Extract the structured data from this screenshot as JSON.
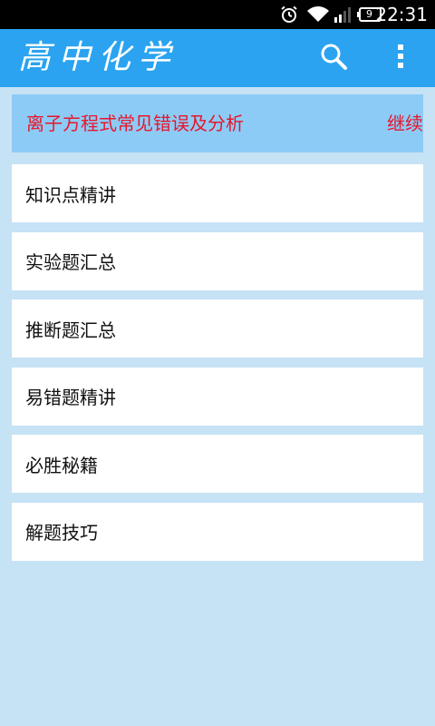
{
  "status_bar": {
    "time": "22:31",
    "battery_level": "9",
    "icons": [
      "alarm-icon",
      "wifi-icon",
      "signal-icon",
      "battery-icon"
    ]
  },
  "app_bar": {
    "title": "高中化学",
    "color": "#2ba3f0",
    "actions": [
      "search-icon",
      "overflow-menu-icon"
    ]
  },
  "banner": {
    "text": "离子方程式常见错误及分析",
    "trailing_text": "继续",
    "text_color": "#e8162a",
    "background": "#8dcbf7"
  },
  "menu": {
    "items": [
      {
        "label": "知识点精讲"
      },
      {
        "label": "实验题汇总"
      },
      {
        "label": "推断题汇总"
      },
      {
        "label": "易错题精讲"
      },
      {
        "label": "必胜秘籍"
      },
      {
        "label": "解题技巧"
      }
    ]
  },
  "colors": {
    "background": "#c6e2f5",
    "item_background": "#ffffff"
  }
}
